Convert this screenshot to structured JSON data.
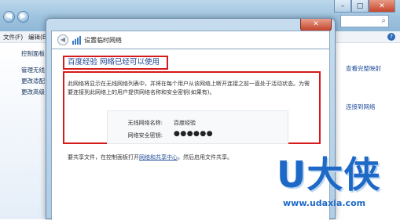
{
  "background_window": {
    "menu": [
      "文件(F)",
      "编辑(E)"
    ],
    "sidebar_links": [
      "控制面板",
      "管理无线",
      "更改适配",
      "更改高级"
    ],
    "right_links": [
      "查看完整映射",
      "连接到网络"
    ],
    "help_label": "?"
  },
  "dialog": {
    "title": "设置临时网络",
    "close_label": "✕",
    "heading": "百度经验  网络已经可以使用",
    "description": "此网络将显示在无线网络列表中，并将在每个用户从该网络上断开连接之前一直处于活动状态。为需要连接到此网络上的用户提供网络名称和安全密钥(如果有)。",
    "network_name_label": "无线网络名称:",
    "network_name_value": "百度经验",
    "security_key_label": "网络安全密钥:",
    "security_key_value": "●●●●●●",
    "share_prefix": "要共享文件，在控制面板打开",
    "share_link": "网络和共享中心",
    "share_suffix": "，然后启用文件共享。"
  },
  "watermark": {
    "brand": "U大侠",
    "url": "www.udaxia.com"
  },
  "colors": {
    "highlight_red": "#d51a1a",
    "heading_blue": "#1c3f8f",
    "watermark_blue": "#1e68c6"
  }
}
